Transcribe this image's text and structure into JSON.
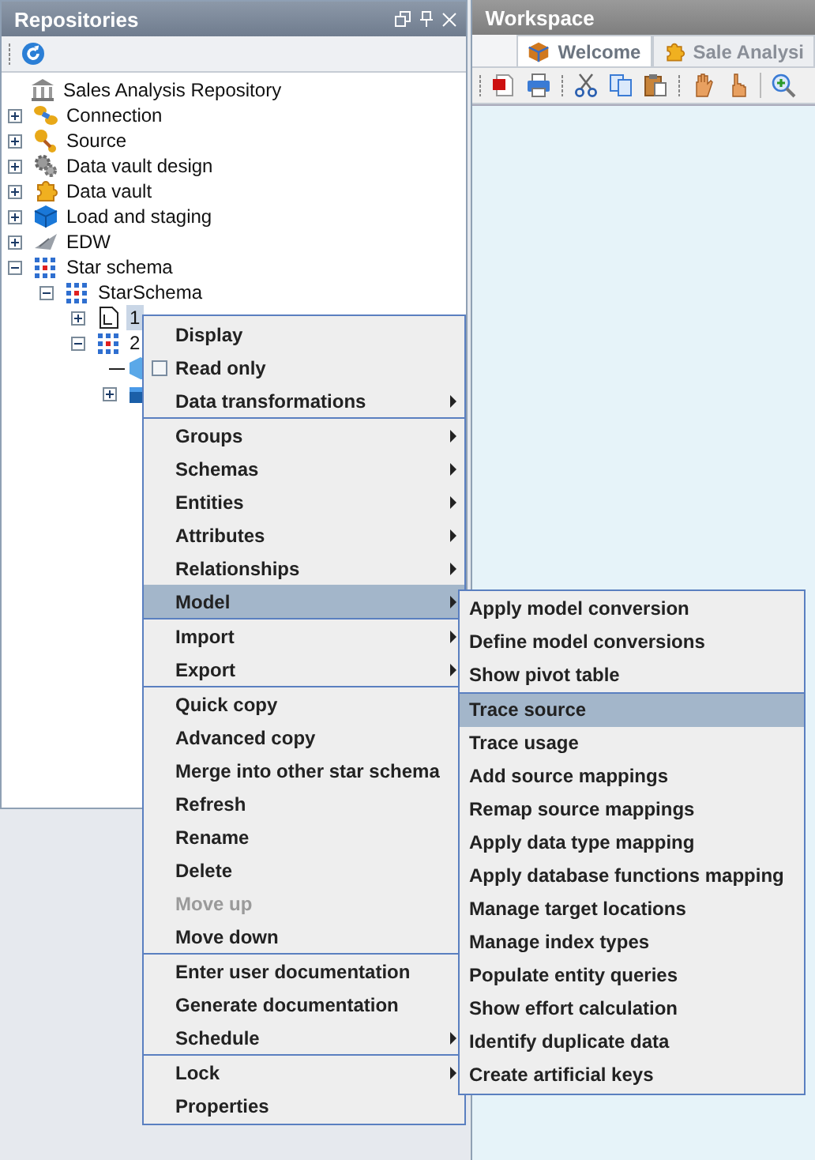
{
  "repositories": {
    "title": "Repositories",
    "tree": [
      {
        "label": "Sales Analysis Repository",
        "selected": false,
        "children": [
          {
            "label": "Connection",
            "expanded": false,
            "selected": false
          },
          {
            "label": "Source",
            "expanded": false,
            "selected": false
          },
          {
            "label": "Data vault design",
            "expanded": false,
            "selected": false
          },
          {
            "label": "Data vault",
            "expanded": false,
            "selected": false
          },
          {
            "label": "Load and staging",
            "expanded": false,
            "selected": false
          },
          {
            "label": "EDW",
            "expanded": false,
            "selected": false
          },
          {
            "label": "Star schema",
            "expanded": true,
            "selected": false,
            "children": [
              {
                "label": "StarSchema",
                "expanded": true,
                "selected": false,
                "children": [
                  {
                    "label": "1",
                    "expanded": false,
                    "selected": true
                  },
                  {
                    "label": "2",
                    "expanded": true,
                    "selected": false,
                    "children": [
                      {
                        "kind": "leaf"
                      },
                      {
                        "expanded": false
                      }
                    ]
                  }
                ]
              }
            ]
          }
        ]
      }
    ]
  },
  "workspace": {
    "title": "Workspace",
    "tabs": [
      {
        "label": "Welcome",
        "selected": true
      },
      {
        "label": "Sale Analysi",
        "selected": false
      }
    ]
  },
  "context_menu": {
    "sections": [
      {
        "items": [
          {
            "label": "Display",
            "kind": "action",
            "submenu": false,
            "selected": false,
            "disabled": false
          },
          {
            "label": "Read only",
            "kind": "checkbox",
            "checked": false,
            "submenu": false,
            "selected": false,
            "disabled": false
          },
          {
            "label": "Data transformations",
            "kind": "action",
            "submenu": true,
            "selected": false,
            "disabled": false
          }
        ]
      },
      {
        "items": [
          {
            "label": "Groups",
            "kind": "action",
            "submenu": true,
            "selected": false,
            "disabled": false
          },
          {
            "label": "Schemas",
            "kind": "action",
            "submenu": true,
            "selected": false,
            "disabled": false
          },
          {
            "label": "Entities",
            "kind": "action",
            "submenu": true,
            "selected": false,
            "disabled": false
          },
          {
            "label": "Attributes",
            "kind": "action",
            "submenu": true,
            "selected": false,
            "disabled": false
          },
          {
            "label": "Relationships",
            "kind": "action",
            "submenu": true,
            "selected": false,
            "disabled": false
          },
          {
            "label": "Model",
            "kind": "action",
            "submenu": true,
            "selected": true,
            "disabled": false
          }
        ]
      },
      {
        "items": [
          {
            "label": "Import",
            "kind": "action",
            "submenu": true,
            "selected": false,
            "disabled": false
          },
          {
            "label": "Export",
            "kind": "action",
            "submenu": true,
            "selected": false,
            "disabled": false
          }
        ]
      },
      {
        "items": [
          {
            "label": "Quick copy",
            "kind": "action",
            "submenu": false,
            "selected": false,
            "disabled": false
          },
          {
            "label": "Advanced copy",
            "kind": "action",
            "submenu": false,
            "selected": false,
            "disabled": false
          },
          {
            "label": "Merge into other star schema",
            "kind": "action",
            "submenu": false,
            "selected": false,
            "disabled": false
          },
          {
            "label": "Refresh",
            "kind": "action",
            "submenu": false,
            "selected": false,
            "disabled": false
          },
          {
            "label": "Rename",
            "kind": "action",
            "submenu": false,
            "selected": false,
            "disabled": false
          },
          {
            "label": "Delete",
            "kind": "action",
            "submenu": false,
            "selected": false,
            "disabled": false
          },
          {
            "label": "Move up",
            "kind": "action",
            "submenu": false,
            "selected": false,
            "disabled": true
          },
          {
            "label": "Move down",
            "kind": "action",
            "submenu": false,
            "selected": false,
            "disabled": false
          }
        ]
      },
      {
        "items": [
          {
            "label": "Enter user documentation",
            "kind": "action",
            "submenu": false,
            "selected": false,
            "disabled": false
          },
          {
            "label": "Generate documentation",
            "kind": "action",
            "submenu": false,
            "selected": false,
            "disabled": false
          },
          {
            "label": "Schedule",
            "kind": "action",
            "submenu": true,
            "selected": false,
            "disabled": false
          }
        ]
      },
      {
        "items": [
          {
            "label": "Lock",
            "kind": "action",
            "submenu": true,
            "selected": false,
            "disabled": false
          },
          {
            "label": "Properties",
            "kind": "action",
            "submenu": false,
            "selected": false,
            "disabled": false
          }
        ]
      }
    ]
  },
  "model_submenu": {
    "sections": [
      {
        "items": [
          {
            "label": "Apply model conversion",
            "selected": false
          },
          {
            "label": "Define model conversions",
            "selected": false
          },
          {
            "label": "Show pivot table",
            "selected": false
          }
        ]
      },
      {
        "items": [
          {
            "label": "Trace source",
            "selected": true
          },
          {
            "label": "Trace usage",
            "selected": false
          },
          {
            "label": "Add source mappings",
            "selected": false
          },
          {
            "label": "Remap source mappings",
            "selected": false
          },
          {
            "label": "Apply data type mapping",
            "selected": false
          },
          {
            "label": "Apply database functions mapping",
            "selected": false
          },
          {
            "label": "Manage target locations",
            "selected": false
          },
          {
            "label": "Manage index types",
            "selected": false
          },
          {
            "label": "Populate entity queries",
            "selected": false
          },
          {
            "label": "Show effort calculation",
            "selected": false
          },
          {
            "label": "Identify duplicate data",
            "selected": false
          },
          {
            "label": "Create artificial keys",
            "selected": false
          }
        ]
      }
    ]
  }
}
